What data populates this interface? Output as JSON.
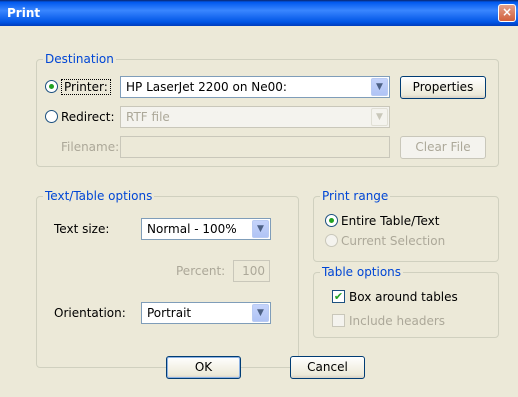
{
  "window": {
    "title": "Print",
    "close_glyph": "×"
  },
  "destination": {
    "legend": "Destination",
    "printer_label": "Printer:",
    "printer_value": "HP LaserJet 2200 on Ne00:",
    "properties_label": "Properties",
    "redirect_label": "Redirect:",
    "redirect_value": "RTF file",
    "filename_label": "Filename:",
    "filename_value": "",
    "clear_file_label": "Clear File"
  },
  "text_options": {
    "legend": "Text/Table options",
    "text_size_label": "Text size:",
    "text_size_value": "Normal - 100%",
    "percent_label": "Percent:",
    "percent_value": "100",
    "orientation_label": "Orientation:",
    "orientation_value": "Portrait"
  },
  "print_range": {
    "legend": "Print range",
    "entire_label": "Entire Table/Text",
    "current_label": "Current Selection"
  },
  "table_options": {
    "legend": "Table options",
    "box_label": "Box around tables",
    "headers_label": "Include headers"
  },
  "buttons": {
    "ok_label": "OK",
    "cancel_label": "Cancel"
  },
  "icons": {
    "dropdown_arrow": "chevron-down-icon",
    "checkmark": "checkmark-icon"
  }
}
